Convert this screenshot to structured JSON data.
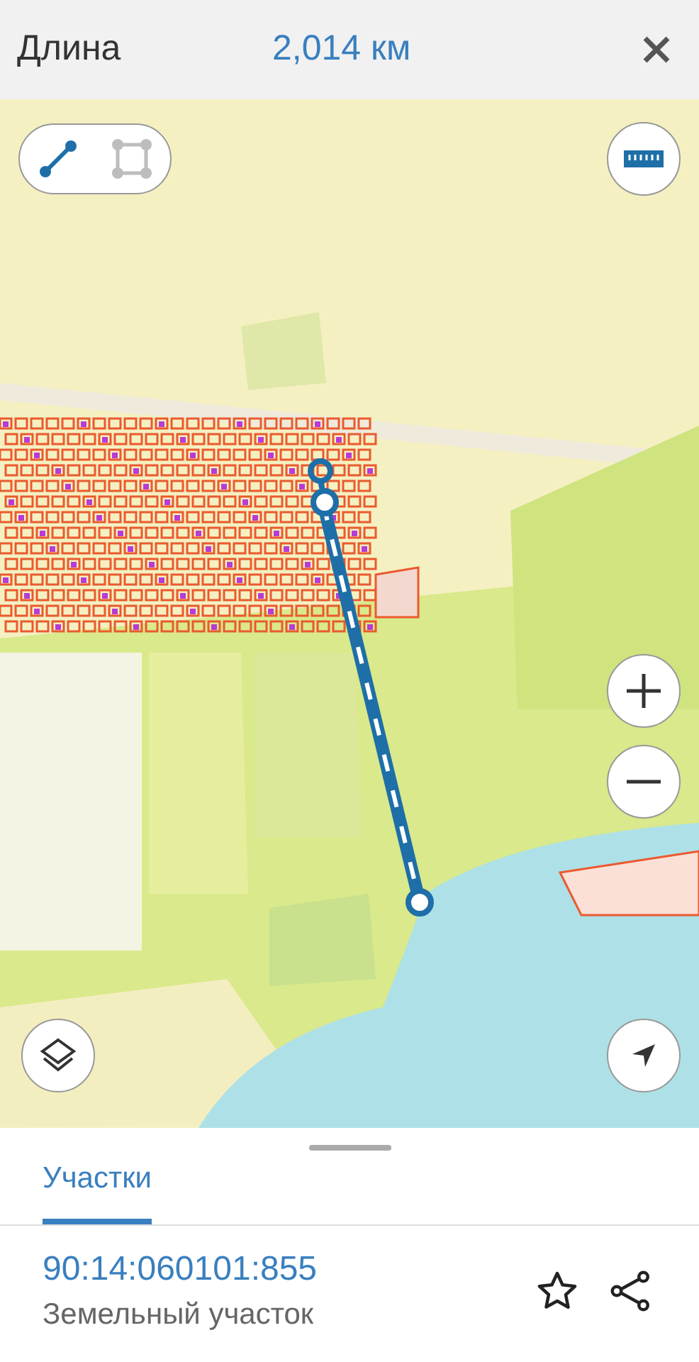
{
  "header": {
    "label": "Длина",
    "value": "2,014 км"
  },
  "modes": [
    {
      "kind": "line",
      "selected": true
    },
    {
      "kind": "polygon",
      "selected": false
    }
  ],
  "tabs": [
    {
      "label": "Участки",
      "selected": true
    }
  ],
  "result": {
    "title": "90:14:060101:855",
    "subtitle": "Земельный участок"
  }
}
